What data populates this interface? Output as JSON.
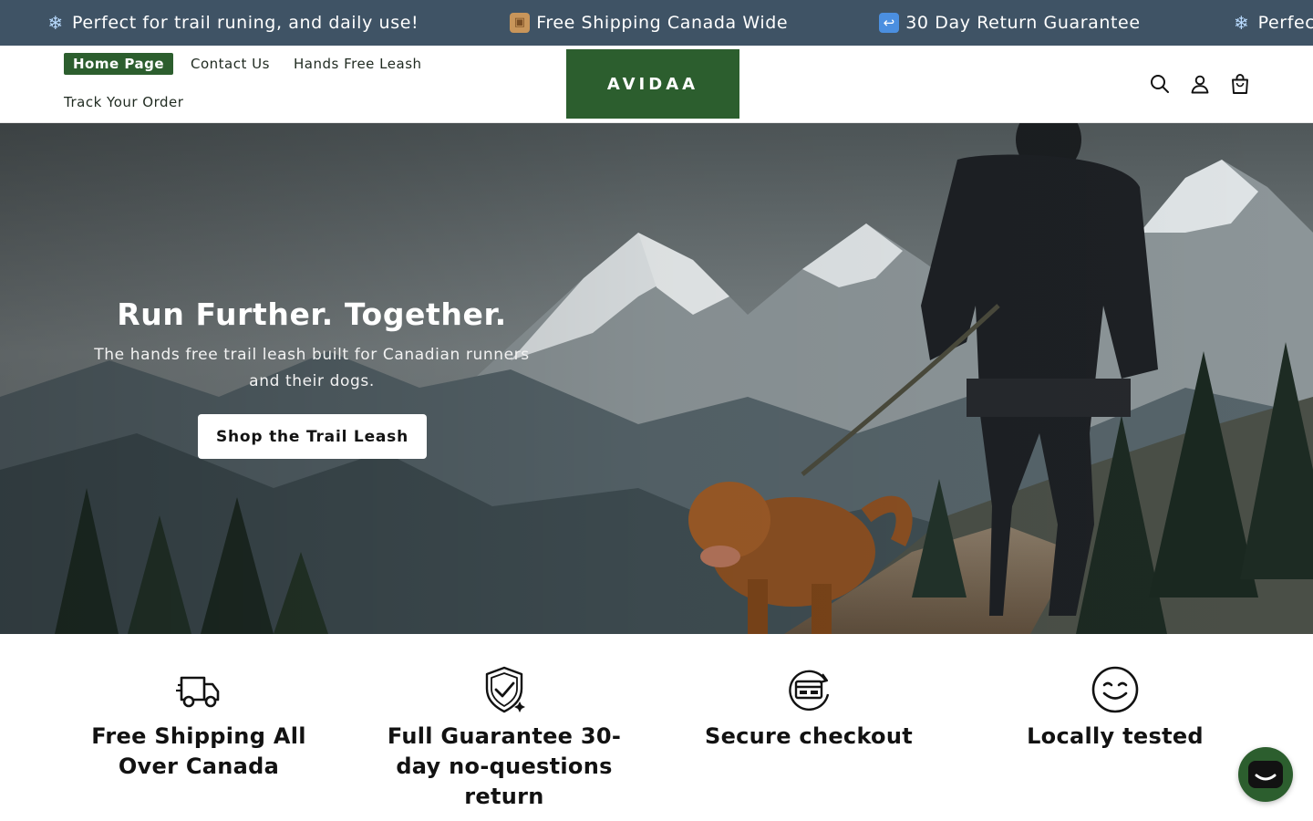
{
  "announcement_bar": {
    "items": [
      {
        "emoji": "❄",
        "text": "Perfect for trail runing, and daily use!"
      },
      {
        "emoji": "▣",
        "text": "Free Shipping Canada Wide"
      },
      {
        "emoji": "↩",
        "text": "30 Day Return Guarantee"
      },
      {
        "emoji": "❄",
        "text": "Perfect f"
      }
    ],
    "background_color": "#3f5365"
  },
  "header": {
    "nav": {
      "home": "Home Page",
      "contact": "Contact Us",
      "leash": "Hands Free Leash",
      "track": "Track Your Order"
    },
    "logo_text": "AVIDAA",
    "brand_color": "#2c5e2e",
    "icons": [
      "search-icon",
      "account-icon",
      "cart-icon"
    ]
  },
  "hero": {
    "title": "Run Further. Together.",
    "subtitle": "The hands free trail leash built for Canadian runners and their dogs.",
    "cta_label": "Shop the Trail Leash"
  },
  "features": [
    {
      "icon": "truck-icon",
      "title": "Free Shipping All Over Canada"
    },
    {
      "icon": "shield-check-icon",
      "title": "Full Guarantee 30-day no-questions return"
    },
    {
      "icon": "secure-card-icon",
      "title": "Secure checkout"
    },
    {
      "icon": "smile-icon",
      "title": "Locally tested"
    }
  ],
  "chat_widget": {
    "icon": "chat-icon"
  }
}
